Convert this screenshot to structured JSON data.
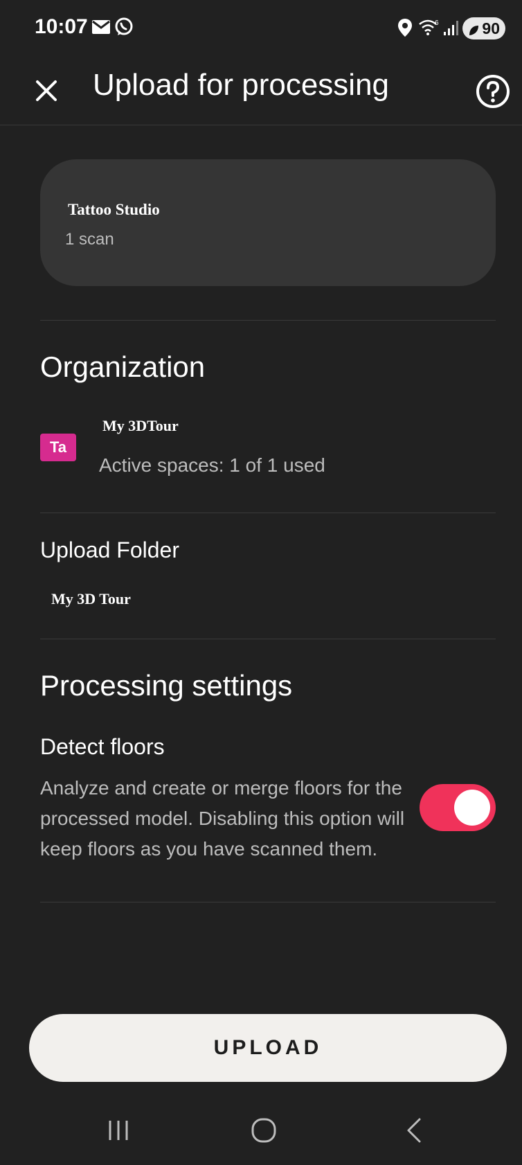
{
  "status_bar": {
    "time": "10:07",
    "battery": "90",
    "icons": [
      "mail-icon",
      "whatsapp-icon",
      "location-icon",
      "wifi-icon",
      "signal-icon",
      "battery-icon"
    ]
  },
  "app_bar": {
    "title": "Upload for processing",
    "close_icon": "close-icon",
    "help_icon": "help-icon"
  },
  "space": {
    "name": "Tattoo Studio",
    "scan_count": "1 scan"
  },
  "organization": {
    "heading": "Organization",
    "avatar_text": "Ta",
    "avatar_color": "#d62b8f",
    "name": "My 3DTour",
    "usage": "Active spaces: 1 of 1 used"
  },
  "upload_folder": {
    "heading": "Upload Folder",
    "name": "My 3D Tour"
  },
  "processing_settings": {
    "heading": "Processing settings",
    "detect_floors": {
      "label": "Detect floors",
      "description": "Analyze and create or merge floors for the processed model. Disabling this option will keep floors as you have scanned them.",
      "enabled": true,
      "accent_color": "#f0325a"
    }
  },
  "actions": {
    "upload_label": "UPLOAD"
  },
  "nav_bar": {
    "items": [
      "recents-icon",
      "home-icon",
      "back-icon"
    ]
  }
}
